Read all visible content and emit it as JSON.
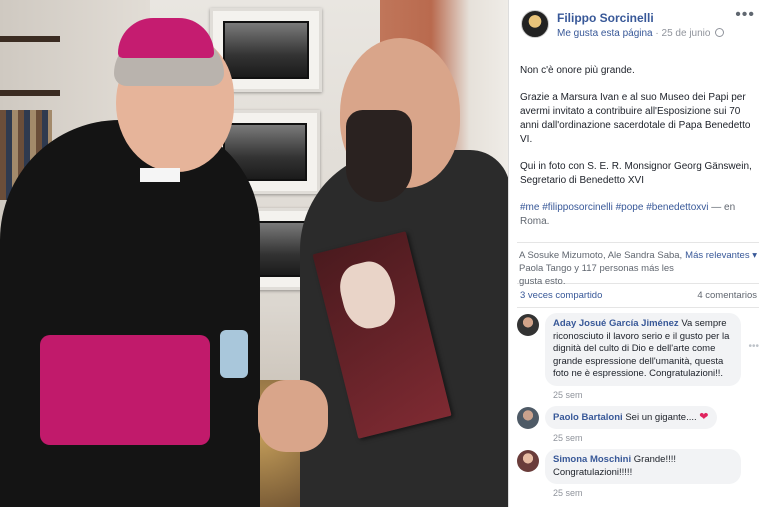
{
  "post": {
    "page_name": "Filippo Sorcinelli",
    "like_page": "Me gusta esta página",
    "date": "25 de junio",
    "paragraph1": "Non c'è onore più grande.",
    "paragraph2": "Grazie a Marsura Ivan e al suo Museo dei Papi per avermi invitato a contribuire all'Esposizione sui 70 anni dall'ordinazione sacerdotale di Papa Benedetto VI.",
    "paragraph3": "Qui in foto con S. E. R. Monsignor Georg Gänswein, Segretario di Benedetto XVI",
    "hashtags": [
      "#me",
      "#filipposorcinelli",
      "#pope",
      "#benedettoxvi"
    ],
    "location": "— en Roma."
  },
  "reactions": {
    "likes_text": "A Sosuke Mizumoto, Ale Sandra Saba, Paola Tango y 117 personas más les gusta esto.",
    "relevance": "Más relevantes ▾",
    "shares": "3 veces compartido",
    "comments_count": "4 comentarios"
  },
  "comments": [
    {
      "author": "Aday Josué García Jiménez",
      "text": "Va sempre riconosciuto il lavoro serio e il gusto per la dignità del culto di Dio e dell'arte come grande espressione dell'umanità, questa foto ne è espressione. Congratulazioni!!.",
      "time": "25 sem"
    },
    {
      "author": "Paolo Bartaloni",
      "text": "Sei un gigante....",
      "time": "25 sem"
    },
    {
      "author": "Simona Moschini",
      "text": "Grande!!!! Congratulazioni!!!!!",
      "time": "25 sem"
    }
  ],
  "icons": {
    "more": "more-options-icon",
    "privacy": "globe-icon",
    "heart": "heart-emoji-icon"
  },
  "colors": {
    "link": "#385898",
    "secondary": "#90949c"
  }
}
